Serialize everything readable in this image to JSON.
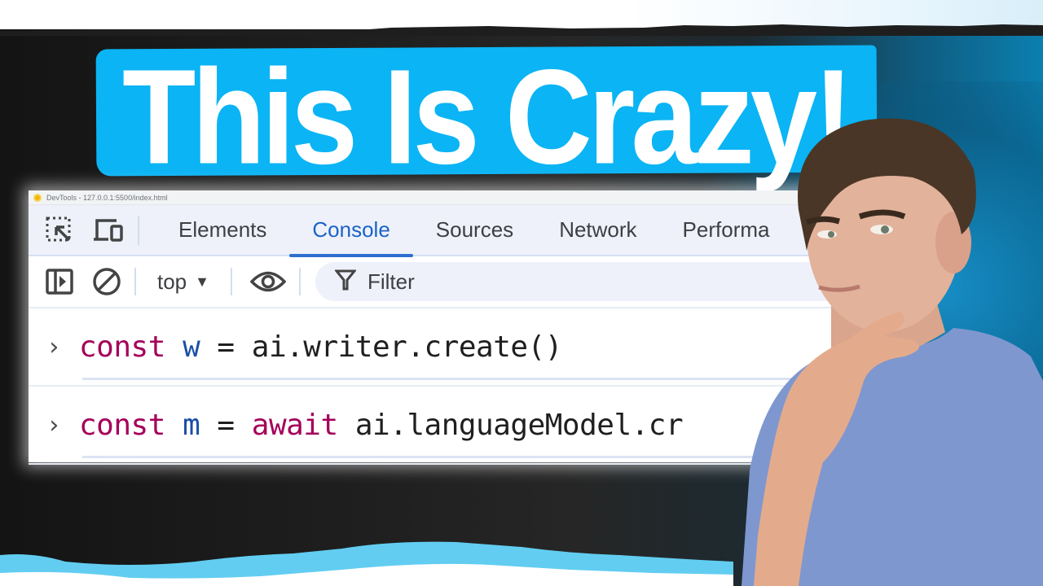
{
  "thumbnail": {
    "headline": "This Is Crazy!",
    "banner_color": "#0bb4f4"
  },
  "devtools": {
    "window_title": "DevTools - 127.0.0.1:5500/index.html",
    "tabs": [
      {
        "label": "Elements",
        "active": false
      },
      {
        "label": "Console",
        "active": true
      },
      {
        "label": "Sources",
        "active": false
      },
      {
        "label": "Network",
        "active": false
      },
      {
        "label": "Performa",
        "active": false
      }
    ],
    "toolbar_icons": [
      "inspect-element-icon",
      "device-toolbar-icon"
    ],
    "console_toolbar": {
      "sidebar_icon": "show-sidebar-icon",
      "clear_icon": "clear-console-icon",
      "context_value": "top",
      "context_arrow": "▼",
      "live_expression_icon": "eye-icon",
      "filter_placeholder": "Filter"
    },
    "console_lines": [
      {
        "prompt": "›",
        "tokens": [
          {
            "text": "const",
            "type": "keyword"
          },
          {
            "text": " ",
            "type": "plain"
          },
          {
            "text": "w",
            "type": "variable"
          },
          {
            "text": " = ai.writer.create()",
            "type": "plain"
          }
        ]
      },
      {
        "prompt": "›",
        "tokens": [
          {
            "text": "const",
            "type": "keyword"
          },
          {
            "text": " ",
            "type": "plain"
          },
          {
            "text": "m",
            "type": "variable"
          },
          {
            "text": " = ",
            "type": "plain"
          },
          {
            "text": "await",
            "type": "keyword"
          },
          {
            "text": " ai.languageModel.cr",
            "type": "plain"
          }
        ]
      }
    ],
    "accent_color": "#1a63c6",
    "keyword_color": "#a4005a",
    "variable_color": "#1a4ea8"
  },
  "presenter": {
    "description": "man in blue t-shirt with hand on chin, thinking pose"
  }
}
